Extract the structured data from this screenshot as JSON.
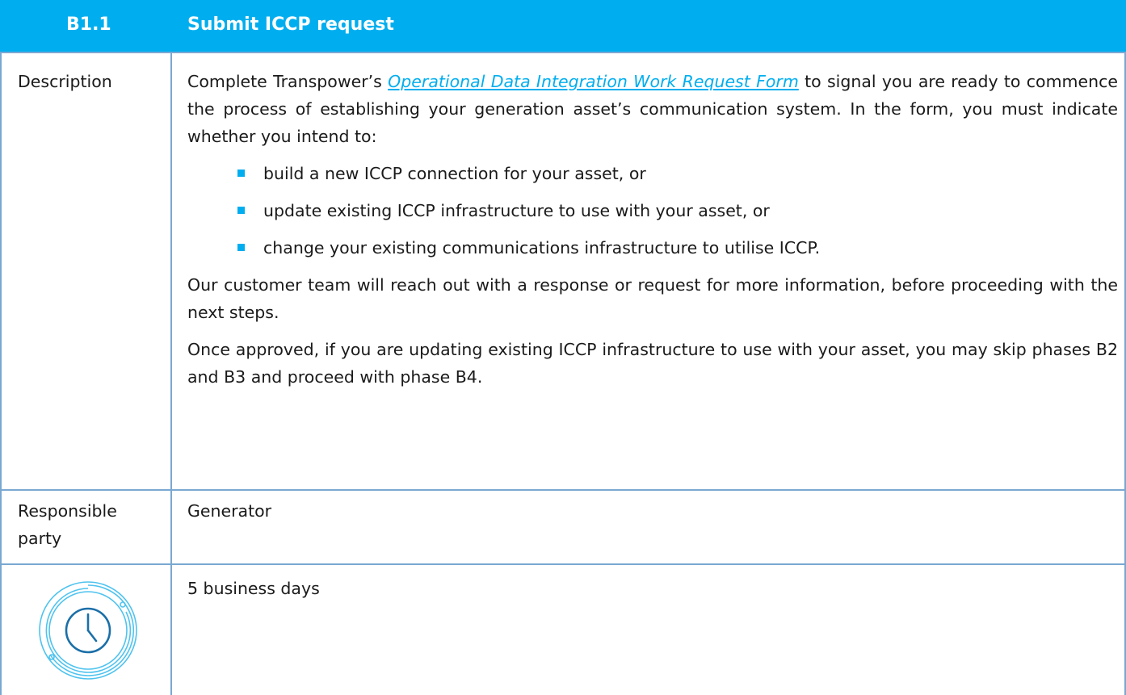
{
  "header": {
    "code": "B1.1",
    "title": "Submit ICCP request"
  },
  "rows": {
    "description": {
      "label": "Description",
      "intro_before_link": "Complete Transpower’s ",
      "link_text": "Operational Data Integration Work Request Form",
      "intro_after_link": " to signal you are ready to commence the process of establishing your generation asset’s communication system. In the form, you must indicate whether you intend to:",
      "bullets": [
        "build a new ICCP connection for your asset, or",
        "update existing ICCP infrastructure to use with your asset, or",
        "change your existing communications infrastructure to utilise ICCP."
      ],
      "para2": "Our customer team will reach out with a response or request for more information, before proceeding with the next steps.",
      "para3": "Once approved, if you are updating existing ICCP infrastructure to use with your asset, you may skip phases B2 and B3 and proceed with phase B4."
    },
    "responsible": {
      "label_line1": "Responsible",
      "label_line2": "party",
      "value": "Generator"
    },
    "duration": {
      "icon": "clock-icon",
      "value": "5 business days"
    }
  },
  "colors": {
    "header_bg": "#00aeef",
    "border": "#7aa8d2",
    "bullet": "#00aeef",
    "link": "#00aeef"
  }
}
